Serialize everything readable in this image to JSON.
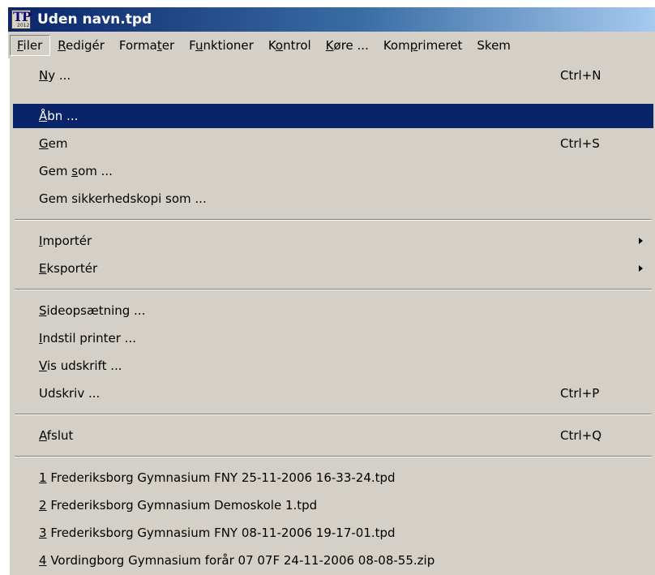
{
  "window": {
    "title": "Uden navn.tpd",
    "icon": {
      "text": "TP",
      "year": "2012"
    }
  },
  "menubar": {
    "items": [
      {
        "pre": "",
        "mn": "F",
        "post": "iler"
      },
      {
        "pre": "",
        "mn": "R",
        "post": "edigér"
      },
      {
        "pre": "Forma",
        "mn": "t",
        "post": "er"
      },
      {
        "pre": "F",
        "mn": "u",
        "post": "nktioner"
      },
      {
        "pre": "K",
        "mn": "o",
        "post": "ntrol"
      },
      {
        "pre": "",
        "mn": "K",
        "post": "øre ..."
      },
      {
        "pre": "Kom",
        "mn": "p",
        "post": "rimeret"
      },
      {
        "pre": "Skem",
        "mn": "",
        "post": ""
      }
    ]
  },
  "file_menu": {
    "items": [
      {
        "pre": "",
        "mn": "N",
        "post": "y ...",
        "shortcut": "Ctrl+N"
      },
      {
        "pre": "",
        "mn": "Å",
        "post": "bn ...",
        "shortcut": ""
      },
      {
        "pre": "",
        "mn": "G",
        "post": "em",
        "shortcut": "Ctrl+S"
      },
      {
        "pre": "Gem ",
        "mn": "s",
        "post": "om ...",
        "shortcut": ""
      },
      {
        "pre": "Gem sikkerhedskopi som ...",
        "mn": "",
        "post": "",
        "shortcut": ""
      },
      {
        "pre": "",
        "mn": "I",
        "post": "mportér",
        "shortcut": ""
      },
      {
        "pre": "",
        "mn": "E",
        "post": "ksportér",
        "shortcut": ""
      },
      {
        "pre": "",
        "mn": "S",
        "post": "ideopsætning ...",
        "shortcut": ""
      },
      {
        "pre": "",
        "mn": "I",
        "post": "ndstil printer ...",
        "shortcut": ""
      },
      {
        "pre": "",
        "mn": "V",
        "post": "is udskrift ...",
        "shortcut": ""
      },
      {
        "pre": "Udskriv ...",
        "mn": "",
        "post": "",
        "shortcut": "Ctrl+P"
      },
      {
        "pre": "",
        "mn": "A",
        "post": "fslut",
        "shortcut": "Ctrl+Q"
      },
      {
        "pre": "",
        "mn": "1",
        "post": " Frederiksborg Gymnasium FNY 25-11-2006 16-33-24.tpd",
        "shortcut": ""
      },
      {
        "pre": "",
        "mn": "2",
        "post": " Frederiksborg Gymnasium Demoskole 1.tpd",
        "shortcut": ""
      },
      {
        "pre": "",
        "mn": "3",
        "post": " Frederiksborg Gymnasium FNY 08-11-2006 19-17-01.tpd",
        "shortcut": ""
      },
      {
        "pre": "",
        "mn": "4",
        "post": " Vordingborg Gymnasium forår  07 07F 24-11-2006 08-08-55.zip",
        "shortcut": ""
      }
    ]
  },
  "colors": {
    "menu_bg": "#d4d0c8",
    "highlight_bg": "#0a246a",
    "title_gradient_start": "#0a246a",
    "title_gradient_end": "#a6caf0"
  },
  "icons": {
    "submenu_arrow": "triangle-right-icon",
    "app": "tp-app-icon"
  }
}
